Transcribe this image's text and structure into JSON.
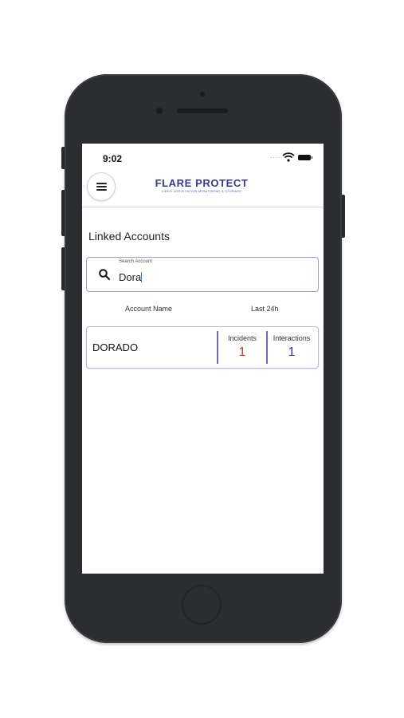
{
  "status_bar": {
    "time": "9:02",
    "signal": "....",
    "icons": [
      "wifi-icon",
      "battery-icon"
    ]
  },
  "header": {
    "menu_icon": "hamburger-menu-icon",
    "logo_title": "FLARE PROTECT",
    "logo_subtitle": "VIDEO VERIFICATION MONITORING & STORAGE"
  },
  "page": {
    "title": "Linked Accounts"
  },
  "search": {
    "label": "Search Account",
    "value": "Dora",
    "icon": "search-icon"
  },
  "table": {
    "headers": {
      "account_name": "Account Name",
      "last_24h": "Last 24h"
    },
    "rows": [
      {
        "name": "DORADO",
        "incidents_label": "Incidents",
        "incidents": "1",
        "interactions_label": "Interactions",
        "interactions": "1"
      }
    ]
  },
  "colors": {
    "brand": "#3b3794",
    "incident": "#c0393b",
    "interaction": "#3b3794",
    "accent_border": "#9e9bcf"
  }
}
